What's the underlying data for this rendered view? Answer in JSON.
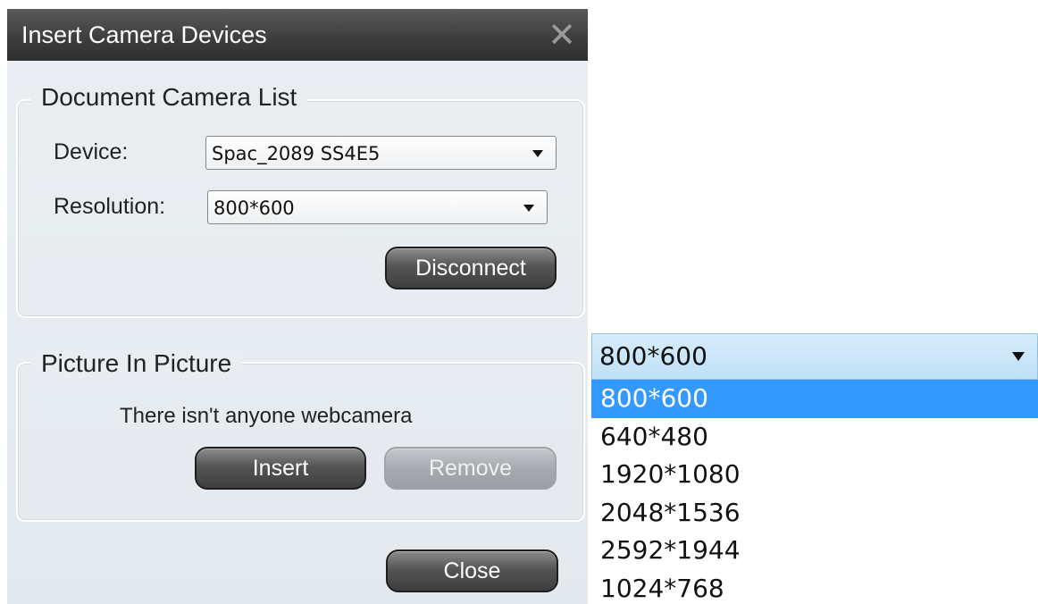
{
  "dialog": {
    "title": "Insert Camera Devices",
    "close_glyph": "✕"
  },
  "camera_list": {
    "legend": "Document Camera List",
    "device_label": "Device:",
    "device_value": "Spac_2089 SS4E5",
    "resolution_label": "Resolution:",
    "resolution_value": "800*600",
    "disconnect_label": "Disconnect"
  },
  "pip": {
    "legend": "Picture In Picture",
    "message": "There isn't anyone webcamera",
    "insert_label": "Insert",
    "remove_label": "Remove"
  },
  "footer": {
    "close_label": "Close"
  },
  "dropdown": {
    "current_value": "800*600",
    "options": [
      "800*600",
      "640*480",
      "1920*1080",
      "2048*1536",
      "2592*1944",
      "1024*768"
    ],
    "selected_index": 0
  },
  "colors": {
    "titlebar": "#3c3c3c",
    "selection": "#3399ff",
    "combo_highlight": "#bfe1f7"
  }
}
